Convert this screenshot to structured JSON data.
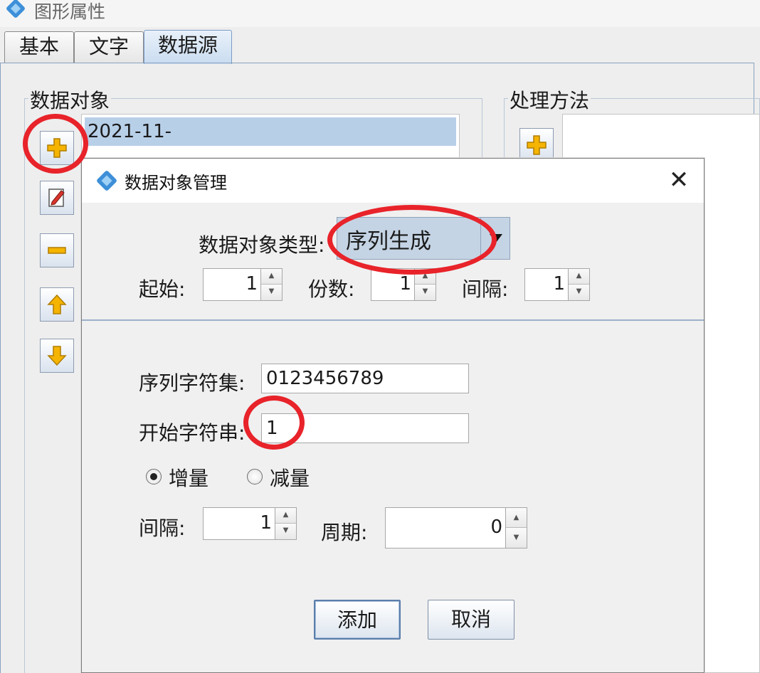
{
  "window": {
    "title": "图形属性"
  },
  "tabs": [
    {
      "label": "基本",
      "active": false
    },
    {
      "label": "文字",
      "active": false
    },
    {
      "label": "数据源",
      "active": true
    }
  ],
  "data_objects": {
    "group_title": "数据对象",
    "items": [
      "2021-11-"
    ]
  },
  "processing": {
    "group_title": "处理方法"
  },
  "icons": {
    "add": "plus-icon",
    "edit": "edit-icon",
    "remove": "minus-icon",
    "up": "arrow-up-icon",
    "down": "arrow-down-icon",
    "close": "close-icon"
  },
  "dialog": {
    "title": "数据对象管理",
    "close_glyph": "✕",
    "type_label": "数据对象类型:",
    "type_value": "序列生成",
    "start_label": "起始:",
    "start_value": "1",
    "copies_label": "份数:",
    "copies_value": "1",
    "interval_label": "间隔:",
    "interval_value": "1",
    "charset_label": "序列字符集:",
    "charset_value": "0123456789",
    "start_string_label": "开始字符串:",
    "start_string_value": "1",
    "increment_label": "增量",
    "decrement_label": "减量",
    "selected_mode": "increment",
    "step_label": "间隔:",
    "step_value": "1",
    "cycle_label": "周期:",
    "cycle_value": "0",
    "add_button": "添加",
    "cancel_button": "取消"
  },
  "annotation_color": "#e8232a",
  "accent_colors": {
    "selection": "#b8cfe8",
    "combo": "#c5d4e4",
    "icon_yellow": "#f5b400"
  }
}
